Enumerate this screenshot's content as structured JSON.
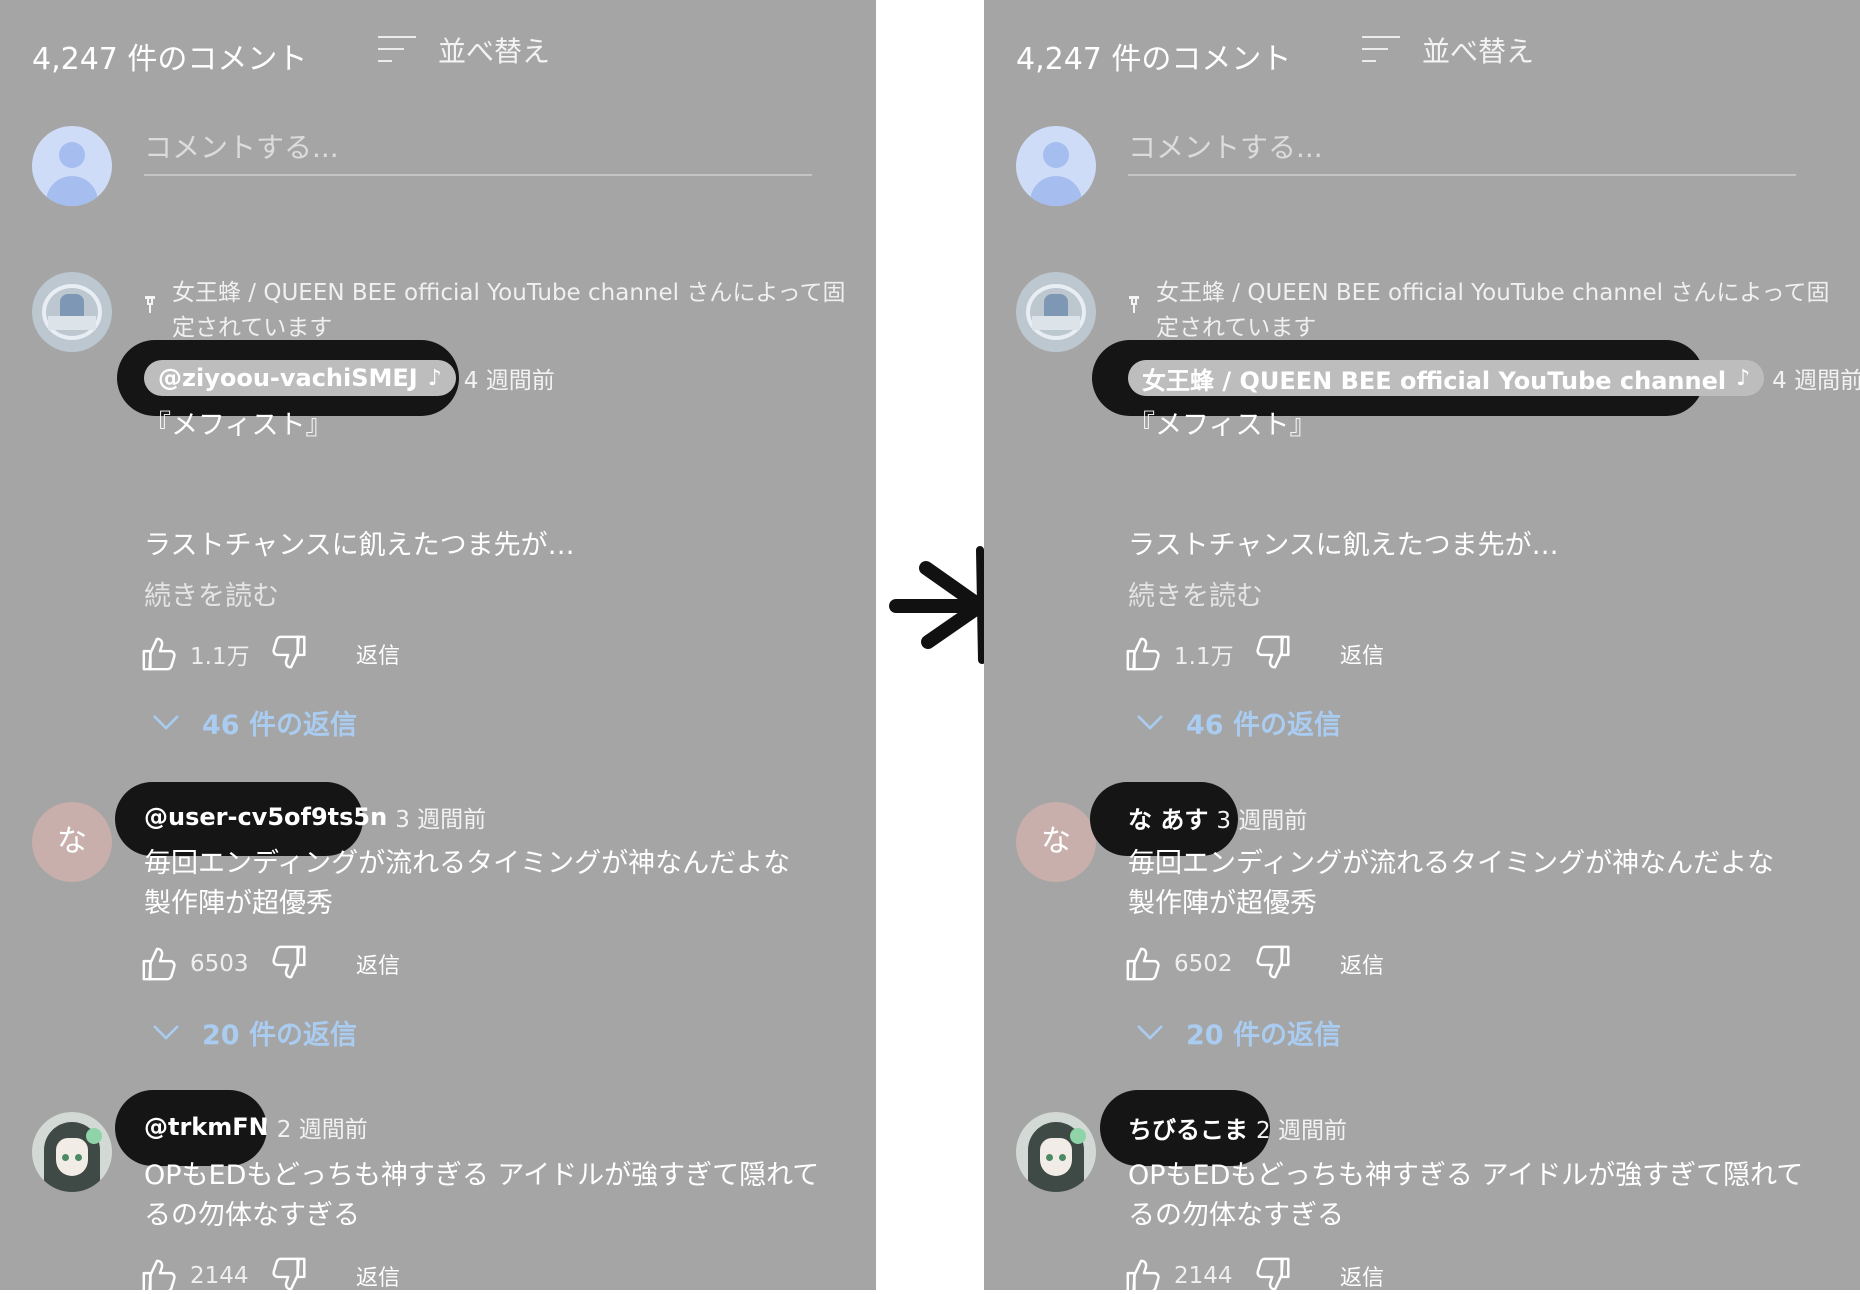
{
  "panels": {
    "left": {
      "comment_count": "4,247 件のコメント",
      "sort_label": "並べ替え",
      "comment_placeholder": "コメントする...",
      "pinned_text": "女王蜂 / QUEEN BEE official YouTube channel さんによって固定されています",
      "comments": [
        {
          "author": "@ziyoou-vachiSMEJ",
          "author_note": "♪",
          "time": "4 週間前",
          "text_lines": [
            "『メフィスト』",
            "",
            "ラストチャンスに飢えたつま先が…"
          ],
          "read_more": "続きを読む",
          "likes": "1.1万",
          "reply_label": "返信",
          "replies_label": "46 件の返信"
        },
        {
          "avatar_letter": "な",
          "author": "@user-cv5of9ts5n",
          "time": "3 週間前",
          "text_lines": [
            "毎回エンディングが流れるタイミングが神なんだよな",
            "製作陣が超優秀"
          ],
          "likes": "6503",
          "reply_label": "返信",
          "replies_label": "20 件の返信"
        },
        {
          "author": "@trkmFN",
          "time": "2 週間前",
          "text_lines": [
            "OPもEDもどっちも神すぎる アイドルが強すぎて隠れて",
            "るの勿体なすぎる"
          ],
          "likes": "2144",
          "reply_label": "返信"
        }
      ]
    },
    "right": {
      "comment_count": "4,247 件のコメント",
      "sort_label": "並べ替え",
      "comment_placeholder": "コメントする...",
      "pinned_text": "女王蜂 / QUEEN BEE official YouTube channel さんによって固定されています",
      "comments": [
        {
          "author": "女王蜂 / QUEEN BEE official YouTube channel",
          "author_note": "♪",
          "time": "4 週間前",
          "text_lines": [
            "『メフィスト』",
            "",
            "ラストチャンスに飢えたつま先が…"
          ],
          "read_more": "続きを読む",
          "likes": "1.1万",
          "reply_label": "返信",
          "replies_label": "46 件の返信"
        },
        {
          "avatar_letter": "な",
          "author": "な あす",
          "time": "3 週間前",
          "text_lines": [
            "毎回エンディングが流れるタイミングが神なんだよな",
            "製作陣が超優秀"
          ],
          "likes": "6502",
          "reply_label": "返信",
          "replies_label": "20 件の返信"
        },
        {
          "author": "ちびるこま",
          "time": "2 週間前",
          "text_lines": [
            "OPもEDもどっちも神すぎる アイドルが強すぎて隠れて",
            "るの勿体なすぎる"
          ],
          "likes": "2144",
          "reply_label": "返信"
        }
      ]
    }
  },
  "colors": {
    "panel_background": "#a5a5a5",
    "highlight_blob": "#151515",
    "replies_link": "#a9ccf0",
    "arrow": "#111111"
  },
  "icons": {
    "sort": "sort-icon",
    "pin": "pin-icon",
    "like": "thumbs-up-icon",
    "dislike": "thumbs-down-icon",
    "expand": "chevron-down-icon",
    "transition": "arrow-right-icon"
  }
}
